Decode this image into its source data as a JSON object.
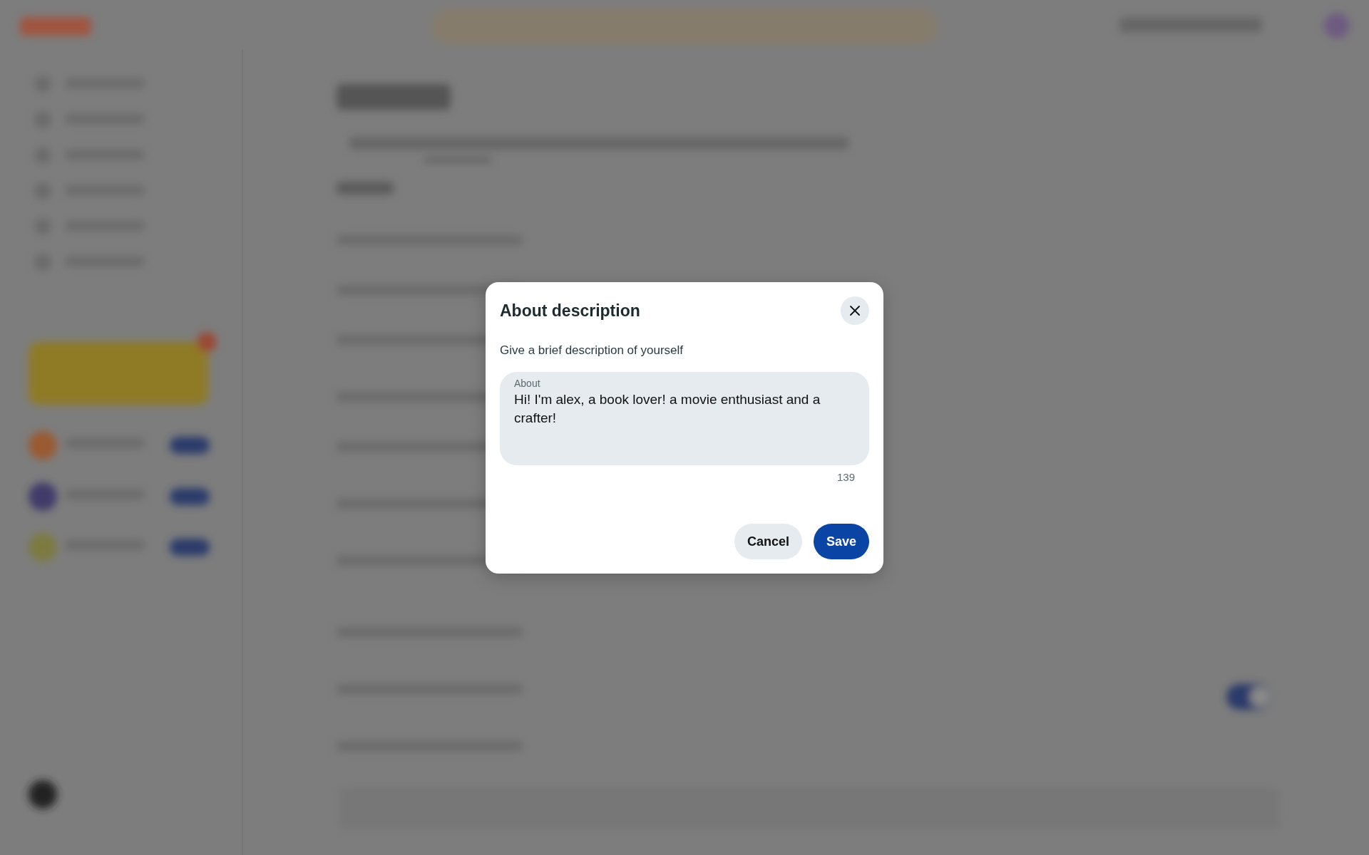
{
  "modal": {
    "title": "About description",
    "description": "Give a brief description of yourself",
    "field": {
      "label": "About",
      "value": "Hi! I'm alex, a book lover! a movie enthusiast and a crafter!"
    },
    "char_count": "139",
    "buttons": [
      {
        "label": "Cancel",
        "kind": "secondary"
      },
      {
        "label": "Save",
        "kind": "primary"
      }
    ]
  }
}
